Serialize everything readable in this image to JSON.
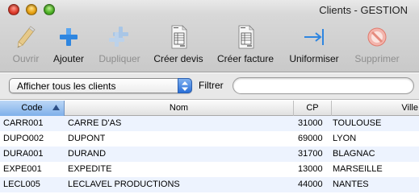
{
  "window": {
    "title": "Clients - GESTION"
  },
  "toolbar": {
    "ouvrir": "Ouvrir",
    "ajouter": "Ajouter",
    "dupliquer": "Dupliquer",
    "creer_devis": "Créer devis",
    "creer_facture": "Créer facture",
    "uniformiser": "Uniformiser",
    "supprimer": "Supprimer"
  },
  "filter": {
    "selected_option": "Afficher tous les clients",
    "label": "Filtrer",
    "value": ""
  },
  "table": {
    "columns": [
      "Code",
      "Nom",
      "CP",
      "Ville"
    ],
    "sorted_column": "Code",
    "rows": [
      {
        "code": "CARR001",
        "nom": "CARRE D'AS",
        "cp": "31000",
        "ville": "TOULOUSE"
      },
      {
        "code": "DUPO002",
        "nom": "DUPONT",
        "cp": "69000",
        "ville": "LYON"
      },
      {
        "code": "DURA001",
        "nom": "DURAND",
        "cp": "31700",
        "ville": "BLAGNAC"
      },
      {
        "code": "EXPE001",
        "nom": "EXPEDITE",
        "cp": "13000",
        "ville": "MARSEILLE"
      },
      {
        "code": "LECL005",
        "nom": "LECLAVEL PRODUCTIONS",
        "cp": "44000",
        "ville": "NANTES"
      }
    ]
  },
  "icons": {
    "ouvrir": "pencil-icon",
    "ajouter": "plus-icon",
    "dupliquer": "duplicate-plus-icon",
    "creer_devis": "document-icon",
    "creer_facture": "document-icon",
    "uniformiser": "arrow-to-bar-icon",
    "supprimer": "no-entry-icon"
  },
  "colors": {
    "accent_blue": "#2a6fd8",
    "row_alt": "#edf3fe",
    "sorted_header": "#9fc4f0",
    "delete_red": "#e04a3a"
  }
}
